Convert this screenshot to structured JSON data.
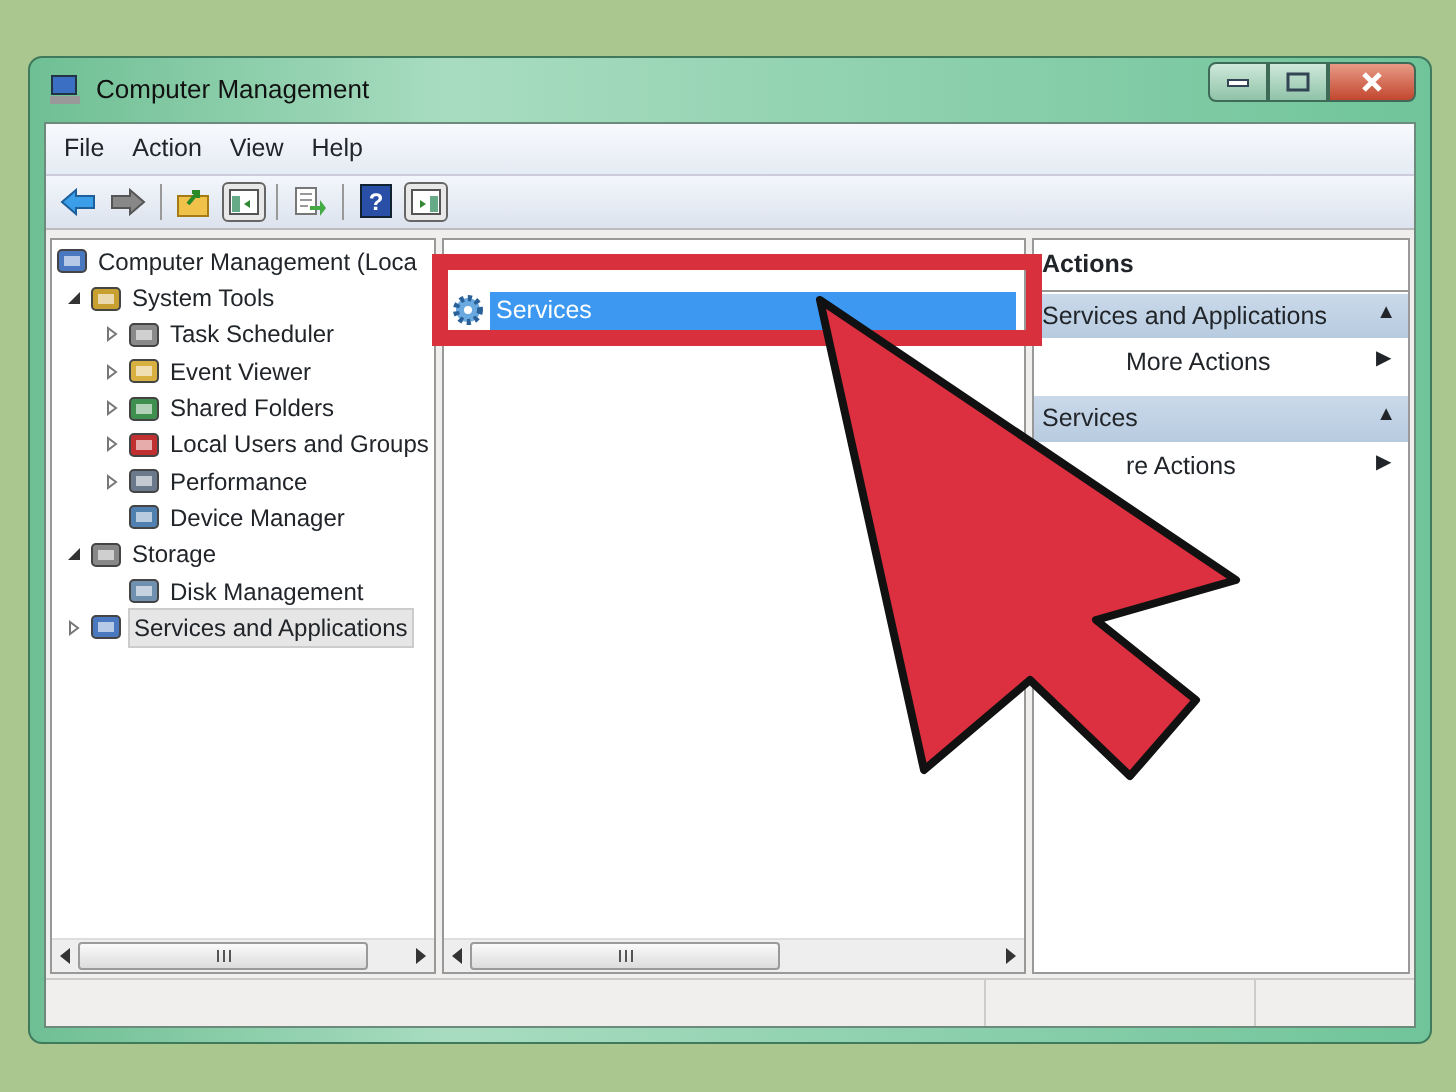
{
  "window": {
    "title": "Computer Management"
  },
  "menu": [
    "File",
    "Action",
    "View",
    "Help"
  ],
  "toolbar": {
    "help_label": "?"
  },
  "tree": [
    {
      "label": "Computer Management (Loca",
      "selected": false,
      "children": [
        {
          "label": "System Tools",
          "selected": false,
          "expanded": true,
          "children": [
            {
              "label": "Task Scheduler",
              "selected": false,
              "expanded": false
            },
            {
              "label": "Event Viewer",
              "selected": false,
              "expanded": false
            },
            {
              "label": "Shared Folders",
              "selected": false,
              "expanded": false
            },
            {
              "label": "Local Users and Groups",
              "selected": false,
              "expanded": false
            },
            {
              "label": "Performance",
              "selected": false,
              "expanded": false
            },
            {
              "label": "Device Manager",
              "selected": false
            }
          ]
        },
        {
          "label": "Storage",
          "selected": false,
          "expanded": true,
          "children": [
            {
              "label": "Disk Management",
              "selected": false
            }
          ]
        },
        {
          "label": "Services and Applications",
          "selected": true,
          "expanded": false
        }
      ]
    }
  ],
  "list": [
    {
      "label": "Services",
      "selected": true
    }
  ],
  "actions": {
    "title": "Actions",
    "sections": [
      {
        "title": "Services and Applications",
        "toggle": "▲",
        "items": [
          {
            "label": "More Actions",
            "arrow": "▶"
          }
        ]
      },
      {
        "title": "Services",
        "toggle": "▲",
        "items": [
          {
            "label": "re Actions",
            "arrow": "▶"
          }
        ]
      }
    ]
  }
}
